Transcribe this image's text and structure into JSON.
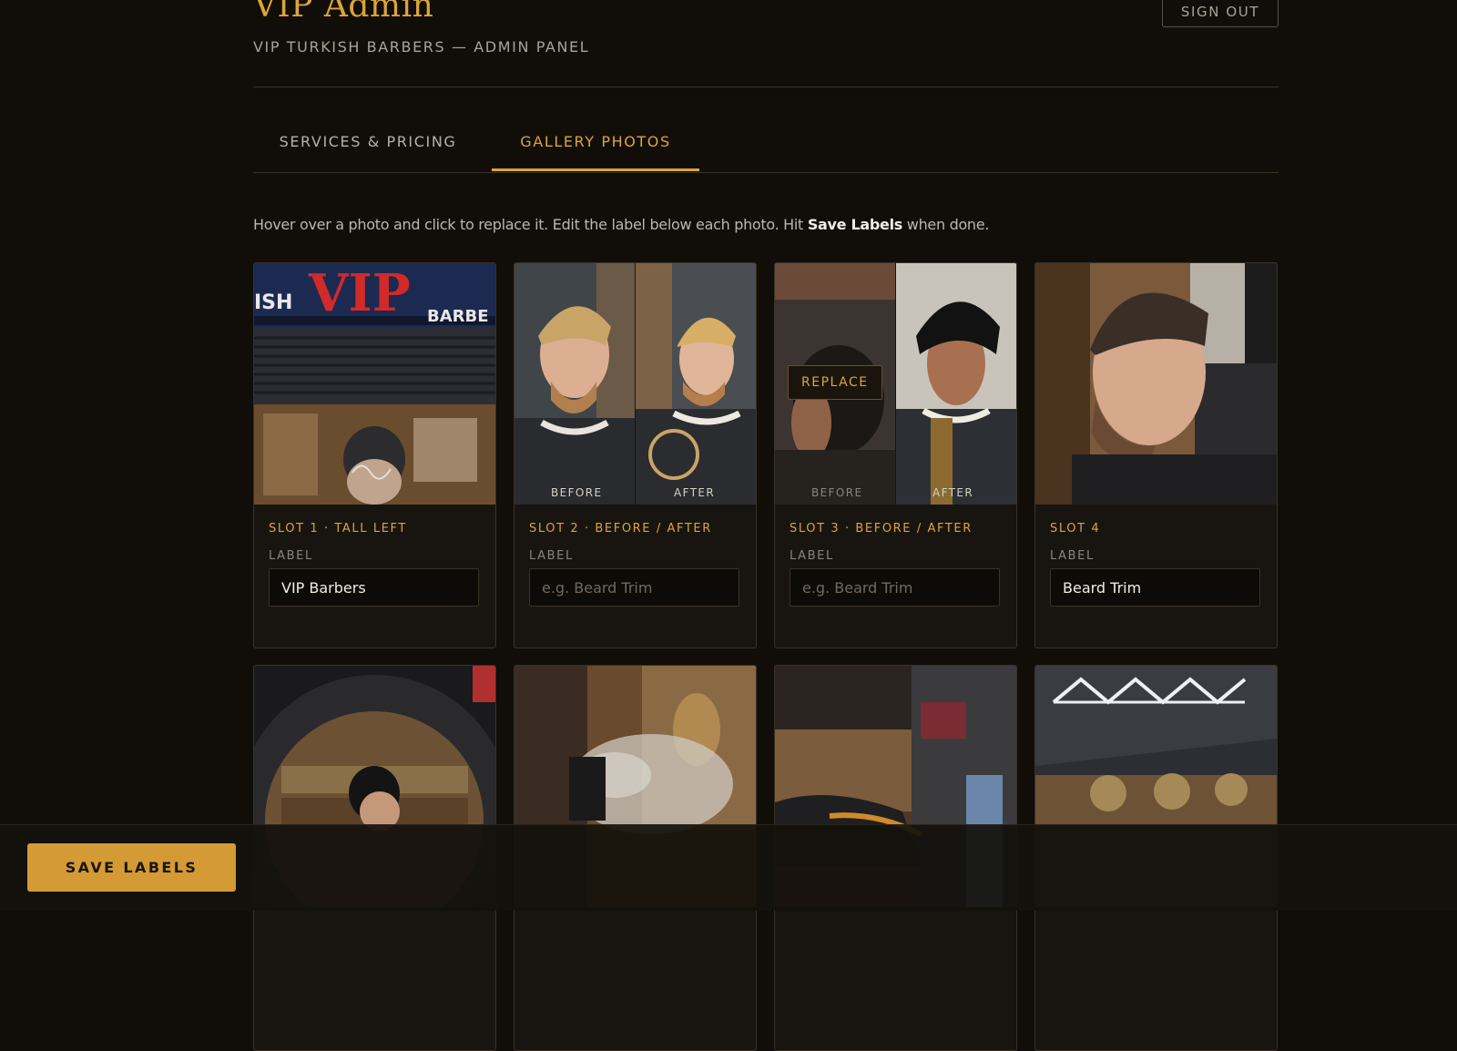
{
  "header": {
    "title": "VIP Admin",
    "subtitle": "VIP TURKISH BARBERS — ADMIN PANEL",
    "sign_out": "SIGN OUT"
  },
  "tabs": [
    {
      "label": "SERVICES & PRICING",
      "active": false
    },
    {
      "label": "GALLERY PHOTOS",
      "active": true
    }
  ],
  "instructions": {
    "before": "Hover over a photo and click to replace it. Edit the label below each photo. Hit ",
    "bold": "Save Labels",
    "after": " when done."
  },
  "field_label": "LABEL",
  "slots": [
    {
      "title": "SLOT 1 · TALL LEFT",
      "value": "VIP Barbers",
      "placeholder": "e.g. Beard Trim"
    },
    {
      "title": "SLOT 2 · BEFORE / AFTER",
      "value": "",
      "placeholder": "e.g. Beard Trim",
      "before_label": "BEFORE",
      "after_label": "AFTER"
    },
    {
      "title": "SLOT 3 · BEFORE / AFTER",
      "value": "",
      "placeholder": "e.g. Beard Trim",
      "before_label": "BEFORE",
      "after_label": "AFTER",
      "replace_label": "REPLACE"
    },
    {
      "title": "SLOT 4",
      "value": "Beard Trim",
      "placeholder": "e.g. Beard Trim"
    }
  ],
  "save_button": "SAVE LABELS",
  "colors": {
    "background": "#110e09",
    "accent": "#d9a63a",
    "button": "#d49a35"
  }
}
